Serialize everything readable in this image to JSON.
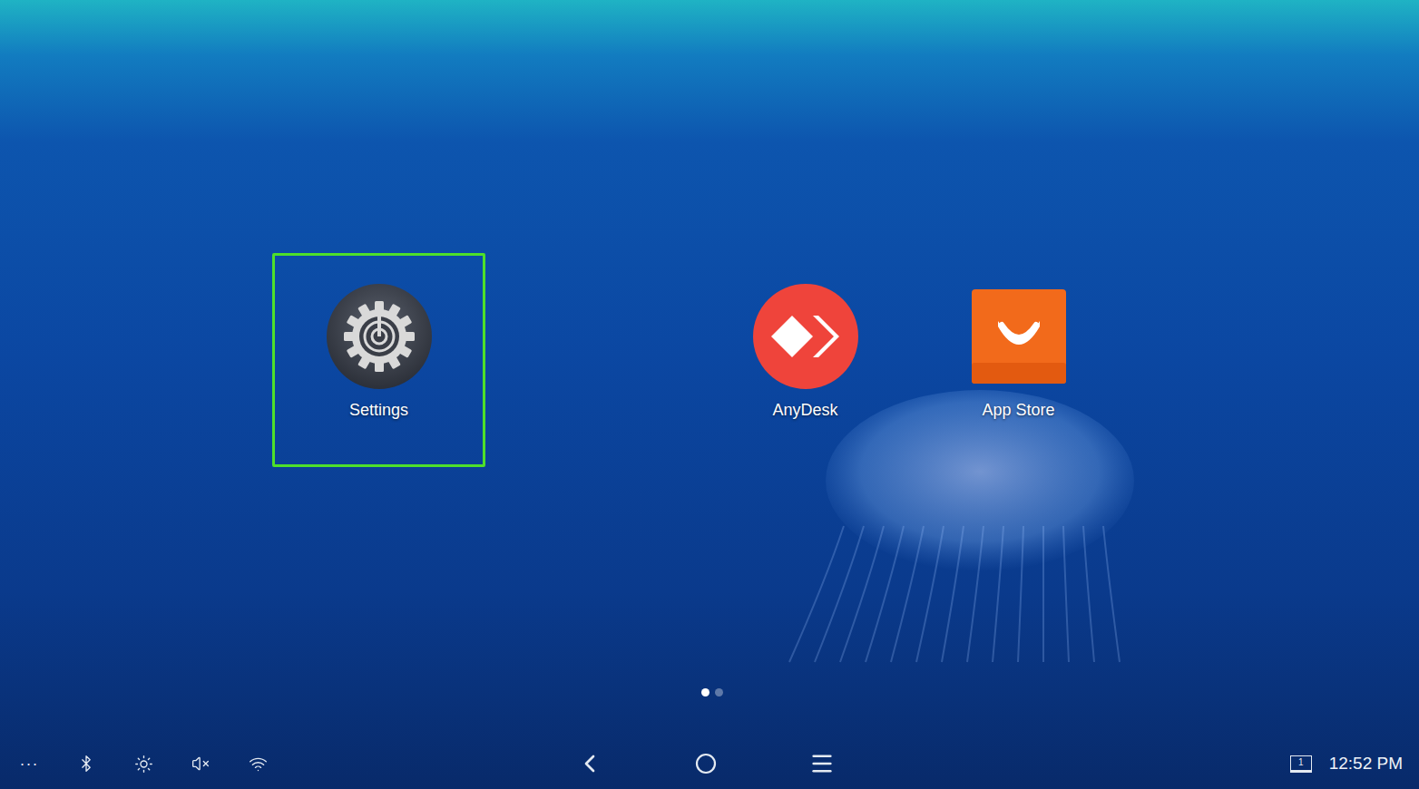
{
  "apps": [
    {
      "label": "Settings",
      "selected": true
    },
    {
      "label": "AnyDesk",
      "selected": false
    },
    {
      "label": "App Store",
      "selected": false
    }
  ],
  "pages": [
    {
      "selected": true
    },
    {
      "selected": false
    }
  ],
  "status_bar": {
    "more": "···",
    "muted": true,
    "display_badge": "1",
    "time": "12:52 PM"
  }
}
